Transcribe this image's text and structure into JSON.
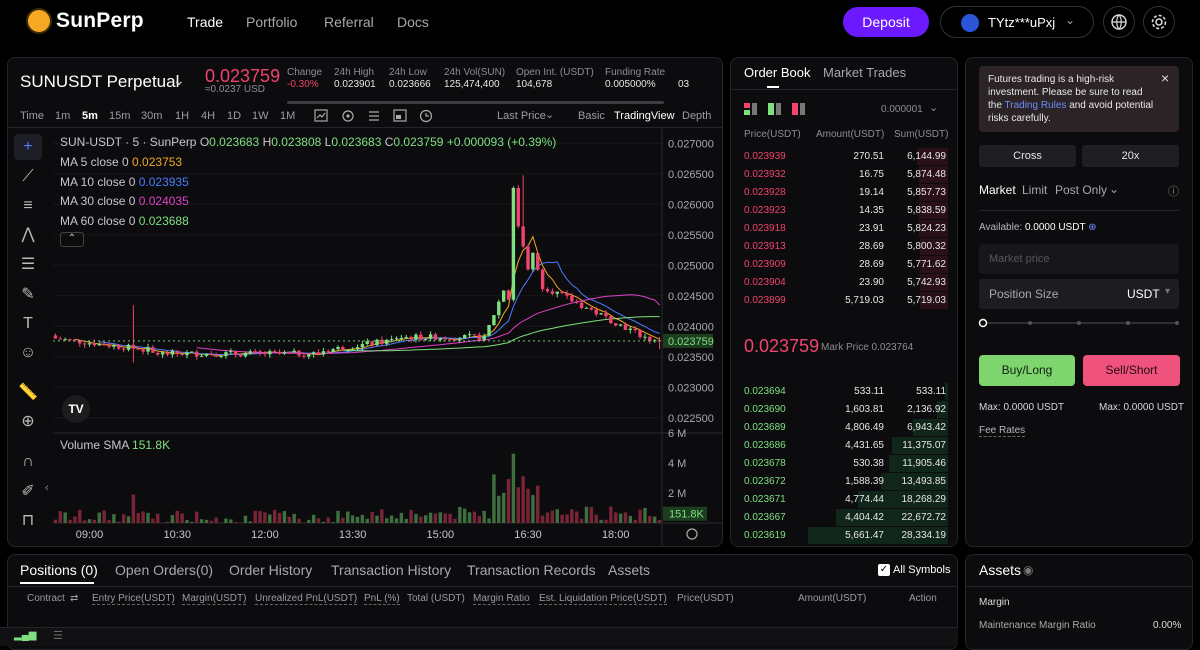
{
  "nav": {
    "brand": "SunPerp",
    "links": [
      "Trade",
      "Portfolio",
      "Referral",
      "Docs"
    ],
    "deposit": "Deposit",
    "wallet": "TYtz***uPxj"
  },
  "ticker": {
    "symbol": "SUNUSDT Perpetual",
    "price": "0.023759",
    "price_usd": "≈0.0237 USD",
    "stats": [
      {
        "label": "Change",
        "value": "-0.30%"
      },
      {
        "label": "24h High",
        "value": "0.023901"
      },
      {
        "label": "24h Low",
        "value": "0.023666"
      },
      {
        "label": "24h Vol(SUN)",
        "value": "125,474,400"
      },
      {
        "label": "Open Int. (USDT)",
        "value": "104,678"
      },
      {
        "label": "Funding Rate",
        "value": "0.005000%"
      },
      {
        "label": "",
        "value": "03"
      }
    ]
  },
  "chart_toolbar": {
    "time_label": "Time",
    "intervals": [
      "1m",
      "5m",
      "15m",
      "30m",
      "1H",
      "4H",
      "1D",
      "1W",
      "1M"
    ],
    "active_interval": "5m",
    "price_source": "Last Price",
    "views": [
      "Basic",
      "TradingView",
      "Depth"
    ],
    "active_view": "TradingView"
  },
  "legend": {
    "title": "SUN-USDT · 5 · SunPerp",
    "ohlc": [
      {
        "k": "O",
        "v": "0.023683"
      },
      {
        "k": "H",
        "v": "0.023808"
      },
      {
        "k": "L",
        "v": "0.023683"
      },
      {
        "k": "C",
        "v": "0.023759"
      }
    ],
    "change": "+0.000093 (+0.39%)",
    "mas": [
      {
        "label": "MA 5 close 0",
        "value": "0.023753",
        "color": "#f6a723"
      },
      {
        "label": "MA 10 close 0",
        "value": "0.023935",
        "color": "#4c7bff"
      },
      {
        "label": "MA 30 close 0",
        "value": "0.024035",
        "color": "#e040c8"
      },
      {
        "label": "MA 60 close 0",
        "value": "0.023688",
        "color": "#7ee07f"
      }
    ],
    "volume_label": "Volume SMA",
    "volume_value": "151.8K"
  },
  "chart_data": {
    "type": "candlestick",
    "price_axis": [
      "0.027000",
      "0.026500",
      "0.026000",
      "0.025500",
      "0.025000",
      "0.024500",
      "0.024000",
      "0.023500",
      "0.023000",
      "0.022500"
    ],
    "price_ylim": [
      0.02225,
      0.02725
    ],
    "current_price_tag": "0.023759",
    "volume_axis": [
      "6 M",
      "4 M",
      "2 M"
    ],
    "volume_ylim": [
      0,
      6000000
    ],
    "volume_tag": "151.8K",
    "time_axis": [
      {
        "label": "09:00",
        "i": 7
      },
      {
        "label": "10:30",
        "i": 25
      },
      {
        "label": "12:00",
        "i": 43
      },
      {
        "label": "13:30",
        "i": 61
      },
      {
        "label": "15:00",
        "i": 79
      },
      {
        "label": "16:30",
        "i": 97
      },
      {
        "label": "18:00",
        "i": 115
      }
    ],
    "candle_count": 125
  },
  "orderbook": {
    "tabs": [
      "Order Book",
      "Market Trades"
    ],
    "precision": "0.000001",
    "headers": [
      "Price(USDT)",
      "Amount(USDT)",
      "Sum(USDT)"
    ],
    "asks": [
      [
        "0.023939",
        "270.51",
        "6,144.99"
      ],
      [
        "0.023932",
        "16.75",
        "5,874.48"
      ],
      [
        "0.023928",
        "19.14",
        "5,857.73"
      ],
      [
        "0.023923",
        "14.35",
        "5,838.59"
      ],
      [
        "0.023918",
        "23.91",
        "5,824.23"
      ],
      [
        "0.023913",
        "28.69",
        "5,800.32"
      ],
      [
        "0.023909",
        "28.69",
        "5,771.62"
      ],
      [
        "0.023904",
        "23.90",
        "5,742.93"
      ],
      [
        "0.023899",
        "5,719.03",
        "5,719.03"
      ]
    ],
    "last_price": "0.023759",
    "mark_label": "Mark Price 0.023764",
    "bids": [
      [
        "0.023694",
        "533.11",
        "533.11"
      ],
      [
        "0.023690",
        "1,603.81",
        "2,136.92"
      ],
      [
        "0.023689",
        "4,806.49",
        "6,943.42"
      ],
      [
        "0.023686",
        "4,431.65",
        "11,375.07"
      ],
      [
        "0.023678",
        "530.38",
        "11,905.46"
      ],
      [
        "0.023672",
        "1,588.39",
        "13,493.85"
      ],
      [
        "0.023671",
        "4,774.44",
        "18,268.29"
      ],
      [
        "0.023667",
        "4,404.42",
        "22,672.72"
      ],
      [
        "0.023619",
        "5,661.47",
        "28,334.19"
      ]
    ],
    "ask_depth": [
      0.22,
      0.21,
      0.21,
      0.21,
      0.21,
      0.2,
      0.2,
      0.2,
      0.2
    ],
    "bid_depth": [
      0.02,
      0.08,
      0.25,
      0.4,
      0.42,
      0.48,
      0.64,
      0.8,
      1.0
    ]
  },
  "order_form": {
    "risk_text": "Futures trading is a high-risk investment. Please be sure to read the",
    "risk_link": "Trading Rules",
    "risk_tail": "and avoid potential risks carefully.",
    "margin_mode": "Cross",
    "leverage": "20x",
    "order_types": [
      "Market",
      "Limit",
      "Post Only"
    ],
    "available_label": "Available:",
    "available_value": "0.0000 USDT",
    "price_placeholder": "Market price",
    "size_placeholder": "Position Size",
    "size_unit": "USDT",
    "buy": "Buy/Long",
    "sell": "Sell/Short",
    "max_buy": "Max: 0.0000 USDT",
    "max_sell": "Max: 0.0000 USDT",
    "fee": "Fee Rates"
  },
  "bottom": {
    "tabs": [
      "Positions (0)",
      "Open Orders(0)",
      "Order History",
      "Transaction History",
      "Transaction Records",
      "Assets"
    ],
    "all_symbols": "All Symbols",
    "columns": [
      "Contract",
      "Entry Price(USDT)",
      "Margin(USDT)",
      "Unrealized PnL(USDT)",
      "PnL (%)",
      "Total (USDT)",
      "Margin Ratio",
      "Est. Liquidation Price(USDT)",
      "Price(USDT)",
      "Amount(USDT)",
      "Action"
    ]
  },
  "assets": {
    "title": "Assets",
    "margin": "Margin",
    "maint_label": "Maintenance Margin Ratio",
    "maint_value": "0.00%"
  }
}
